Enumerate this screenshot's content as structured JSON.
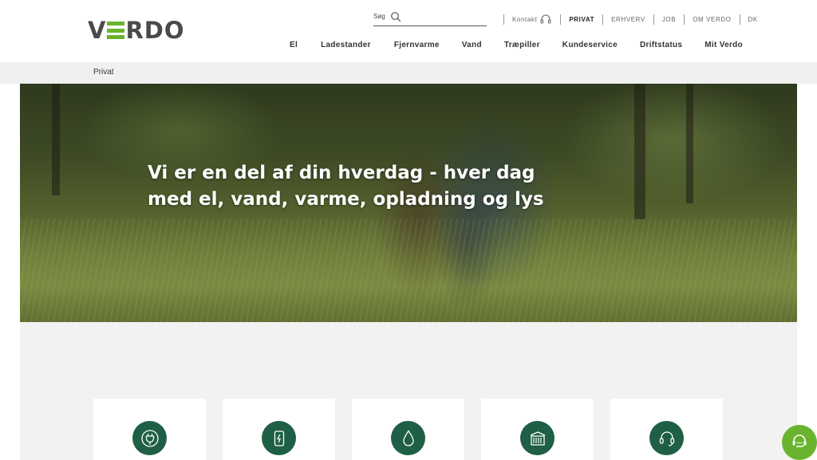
{
  "brand": {
    "logo_text_before": "V",
    "logo_text_after": "RDO",
    "accent_color": "#6ab42d",
    "dark_green": "#1f5f45"
  },
  "search": {
    "label": "Søg",
    "icon": "search-icon"
  },
  "top_links": {
    "contact": "Kontakt",
    "privat": "PRIVAT",
    "erhverv": "ERHVERV",
    "job": "JOB",
    "om_verdo": "OM VERDO",
    "language": "DK"
  },
  "main_nav": [
    "El",
    "Ladestander",
    "Fjernvarme",
    "Vand",
    "Træpiller",
    "Kundeservice",
    "Driftstatus",
    "Mit Verdo"
  ],
  "breadcrumb": "Privat",
  "hero": {
    "title_line1": "Vi er en del af din hverdag - hver dag",
    "title_line2": "med el, vand, varme, opladning og lys"
  },
  "cards": [
    {
      "icon": "plug-icon"
    },
    {
      "icon": "charging-station-icon"
    },
    {
      "icon": "water-drop-icon"
    },
    {
      "icon": "heating-radiator-icon"
    },
    {
      "icon": "headset-icon"
    }
  ],
  "chat": {
    "icon": "chat-icon"
  }
}
